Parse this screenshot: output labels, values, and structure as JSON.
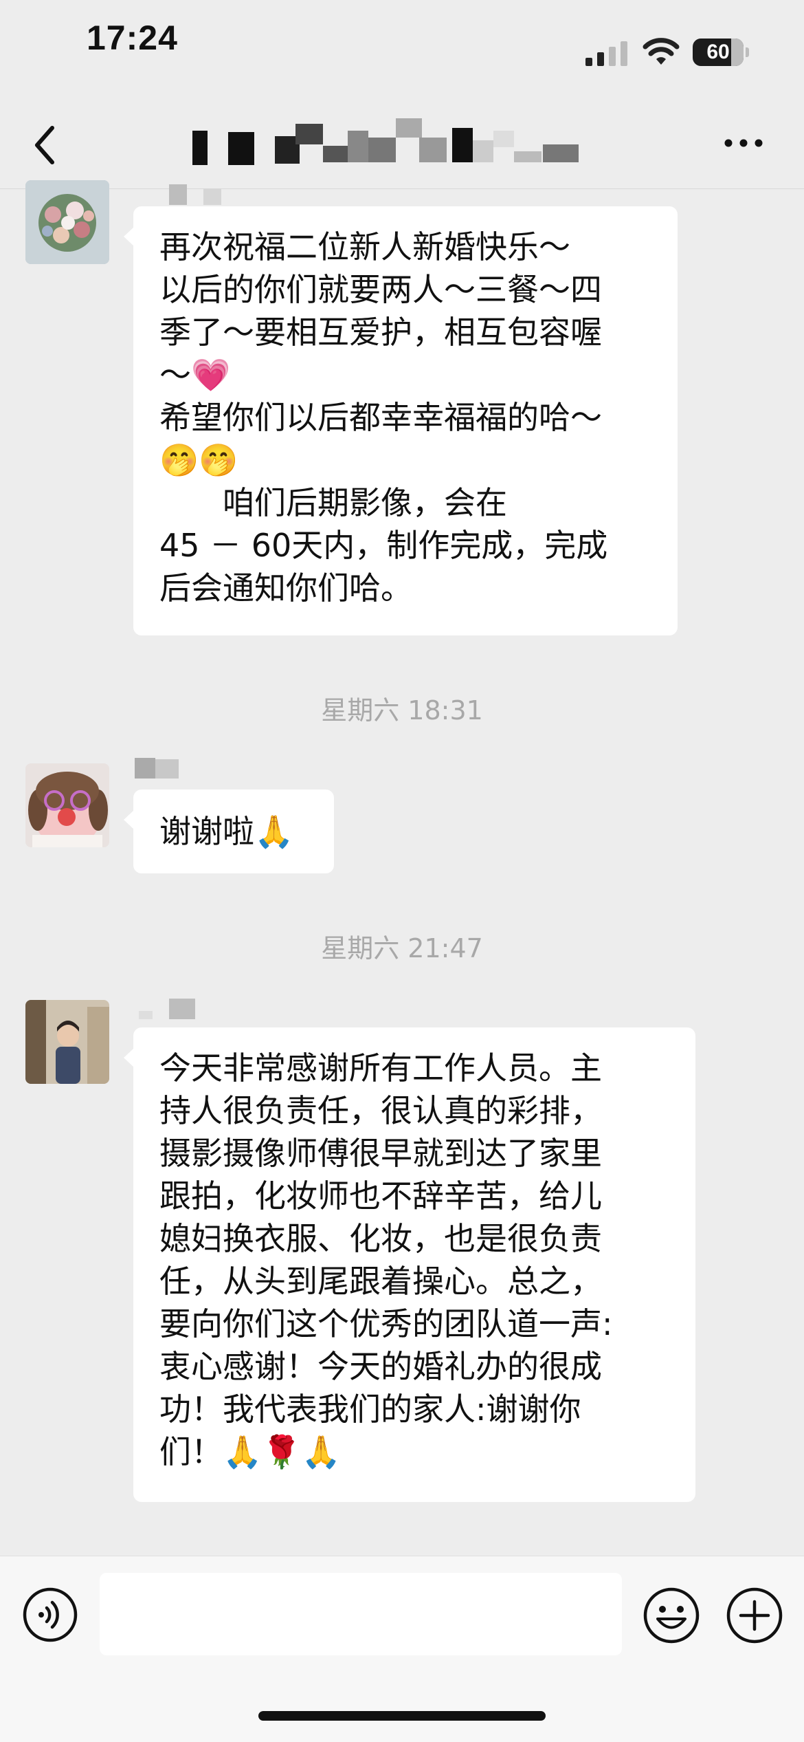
{
  "status_bar": {
    "time": "17:24",
    "battery": "60"
  },
  "nav": {
    "title": ""
  },
  "messages": [
    {
      "lines": [
        "再次祝福二位新人新婚快乐～",
        "以后的你们就要两人～三餐～四",
        "季了～要相互爱护，相互包容喔",
        "～💗",
        "希望你们以后都幸幸福福的哈～",
        "🤭🤭",
        "　　咱们后期影像，会在",
        "45 － 60天内，制作完成，完成",
        "后会通知你们哈。"
      ]
    },
    {
      "lines": [
        "谢谢啦🙏"
      ]
    },
    {
      "lines": [
        "今天非常感谢所有工作人员。主",
        "持人很负责任，很认真的彩排，",
        "摄影摄像师傅很早就到达了家里",
        "跟拍，化妆师也不辞辛苦，给儿",
        "媳妇换衣服、化妆，也是很负责",
        "任，从头到尾跟着操心。总之，",
        "要向你们这个优秀的团队道一声:",
        "衷心感谢！今天的婚礼办的很成",
        "功！我代表我们的家人:谢谢你",
        "们！🙏🌹🙏"
      ]
    }
  ],
  "timestamps": [
    "星期六 18:31",
    "星期六 21:47"
  ],
  "icons": {
    "back": "chevron-left-icon",
    "more": "ellipsis-icon",
    "voice": "voice-icon",
    "emoji": "smiley-icon",
    "plus": "plus-icon"
  },
  "colors": {
    "background": "#ededed",
    "bubble": "#ffffff",
    "timestamp": "#a8a8a8"
  }
}
